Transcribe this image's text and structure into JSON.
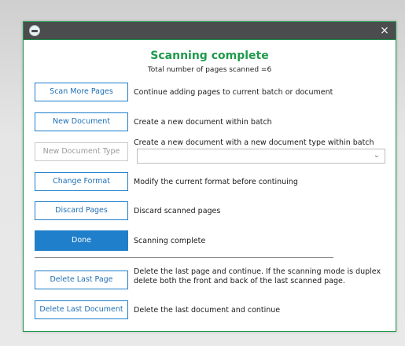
{
  "dialog": {
    "title": "",
    "close_label": "×",
    "heading": "Scanning complete",
    "subheading": "Total number of pages scanned =6"
  },
  "actions": [
    {
      "label": "Scan More Pages",
      "description": "Continue adding pages to current batch or document",
      "state": "enabled"
    },
    {
      "label": "New Document",
      "description": "Create a new document within batch",
      "state": "enabled"
    },
    {
      "label": "New Document Type",
      "description": "Create a new document with a new document type within batch",
      "state": "disabled",
      "dropdown_value": ""
    },
    {
      "label": "Change Format",
      "description": "Modify the current format before continuing",
      "state": "enabled"
    },
    {
      "label": "Discard Pages",
      "description": "Discard scanned pages",
      "state": "enabled"
    },
    {
      "label": "Done",
      "description": "Scanning complete",
      "state": "primary"
    },
    {
      "label": "Delete Last Page",
      "description": "Delete the last page and continue. If the scanning mode is duplex delete both the front and back of the last scanned page.",
      "state": "enabled"
    },
    {
      "label": "Delete Last Document",
      "description": "Delete the last document and continue",
      "state": "enabled"
    }
  ],
  "colors": {
    "accent": "#1f9a4c",
    "button_border": "#1f7fca",
    "primary_fill": "#1f7fca",
    "titlebar": "#4a4c4d"
  },
  "icons": {
    "app": "app-icon",
    "close": "close-icon",
    "dropdown": "chevron-down-icon"
  }
}
